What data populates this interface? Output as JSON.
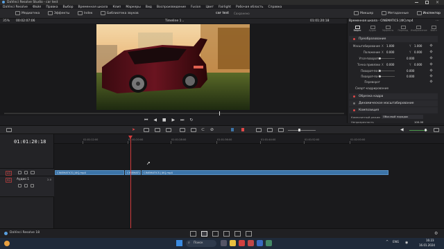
{
  "window": {
    "title": "DaVinci Resolve Studio - car test"
  },
  "menu": [
    "DaVinci Resolve",
    "Файл",
    "Правка",
    "Выбор",
    "Временная шкала",
    "Клип",
    "Маркеры",
    "Вид",
    "Воспроизведение",
    "Fusion",
    "Цвет",
    "Fairlight",
    "Рабочая область",
    "Справка"
  ],
  "toolbar": {
    "media_pool": "Медиатека",
    "effects": "Эффекты",
    "index": "Indeк",
    "sound_library": "Библиотека звуков",
    "project_name": "car test",
    "saved": "Сохранено",
    "mixer": "Микшер",
    "metadata": "Метаданные",
    "inspector": "Инспектор"
  },
  "viewer": {
    "zoom": "35%",
    "timecode_left": "00:02:07:06",
    "timeline_name": "Timeline 1",
    "timecode_right": "01:01:20:18"
  },
  "inspector": {
    "title": "Временная шкала - CINEMATICS [4K].mp4",
    "tabs": [
      "Видео",
      "Аудио",
      "Эффекты",
      "Переход",
      "Изображение",
      "Файл"
    ],
    "transform_label": "Преобразование",
    "rows": [
      {
        "label": "Масштабирование",
        "x_label": "X",
        "x": "1.000",
        "y_label": "Y",
        "y": "1.000"
      },
      {
        "label": "Положение",
        "x_label": "X",
        "x": "0.000",
        "y_label": "Y",
        "y": "0.000"
      },
      {
        "label": "Угол поворота",
        "x": "0.000"
      },
      {
        "label": "Точка привязки",
        "x_label": "X",
        "x": "0.000",
        "y_label": "Y",
        "y": "0.000"
      },
      {
        "label": "Поворот по X",
        "x": "0.000"
      },
      {
        "label": "Поворот по Y",
        "x": "0.000"
      },
      {
        "label": "Переворот"
      }
    ],
    "smart_reframe": "Смарт-кадрирование",
    "cropping": "Обрезка кадра",
    "dynamic_zoom": "Динамическое масштабирование",
    "composite": "Композиция",
    "composite_mode_label": "Композитный режим",
    "composite_mode_value": "Обычный порядок",
    "opacity_label": "Непрозрачность",
    "opacity_value": "100.00"
  },
  "timeline": {
    "timecode": "01:01:20:18",
    "ruler": [
      "01:01:12:00",
      "01:01:20:00",
      "01:01:28:00",
      "01:01:36:00",
      "01:01:44:00",
      "01:01:52:00",
      "01:02:00:00"
    ],
    "video_track": {
      "id": "V1"
    },
    "audio_track": {
      "id": "A1",
      "name": "Аудио 1",
      "channels": "2.0"
    },
    "clips": [
      "CINEMATICS [4K].mp4",
      "CINEMATI...",
      "CINEMATICS [4K].mp4"
    ]
  },
  "footer": {
    "app": "DaVinci Resolve 18"
  },
  "taskbar": {
    "search": "Поиск",
    "lang": "ENG",
    "time": "16:23",
    "date": "16.01.2024"
  },
  "colors": {
    "accent": "#e04848",
    "clip": "#3c74a8",
    "playhead": "#d23c3c",
    "bg": "#1e1e21"
  }
}
